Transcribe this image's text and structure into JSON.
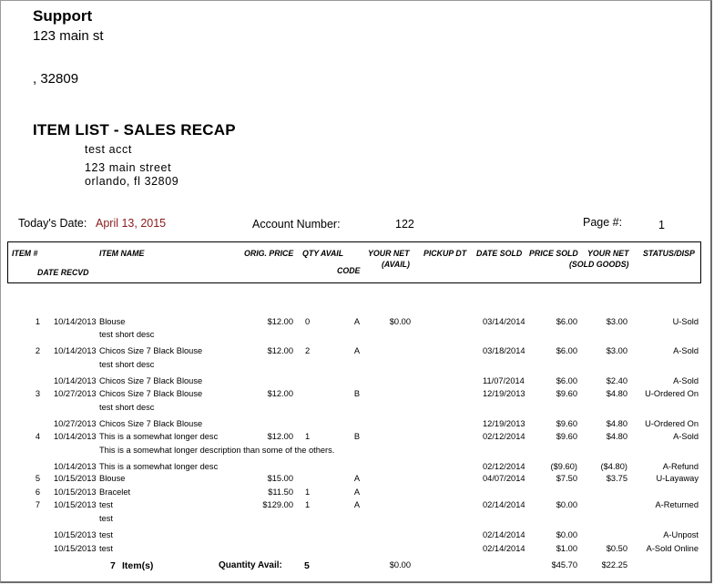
{
  "company": {
    "name": "Support",
    "address_line1": "123 main st",
    "address_line2": ",  32809"
  },
  "report": {
    "title": "ITEM LIST - SALES RECAP",
    "account_name": "test acct",
    "account_street": "123 main street",
    "account_city": "orlando, fl 32809",
    "todays_date_label": "Today's Date:",
    "todays_date_value": "April 13, 2015",
    "account_number_label": "Account Number:",
    "account_number_value": "122",
    "page_label": "Page #:",
    "page_value": "1"
  },
  "columns": {
    "item": "ITEM #",
    "item_name": "ITEM NAME",
    "orig_price": "ORIG. PRICE",
    "qty_avail": "QTY AVAIL",
    "your_net": "YOUR NET",
    "your_net_sub": "(AVAIL)",
    "pickup_dt": "PICKUP DT",
    "date_sold": "DATE SOLD",
    "price_sold": "PRICE SOLD",
    "your_net2": "YOUR NET",
    "your_net2_sub": "(SOLD GOODS)",
    "status": "STATUS/DISP",
    "date_recvd": "DATE RECVD",
    "code": "CODE"
  },
  "rows": [
    {
      "num": "1",
      "recvd": "10/14/2013",
      "name": "Blouse",
      "orig": "$12.00",
      "qty": "0",
      "code": "A",
      "net": "$0.00",
      "sold": "03/14/2014",
      "price": "$6.00",
      "net2": "$3.00",
      "status": "U-Sold"
    },
    {
      "name": "test short desc"
    },
    {
      "num": "2",
      "recvd": "10/14/2013",
      "name": "Chicos Size 7 Black Blouse",
      "orig": "$12.00",
      "qty": "2",
      "code": "A",
      "sold": "03/18/2014",
      "price": "$6.00",
      "net2": "$3.00",
      "status": "A-Sold"
    },
    {
      "name": "test short desc"
    },
    {
      "recvd": "10/14/2013",
      "name": "Chicos Size 7 Black Blouse",
      "sold": "11/07/2014",
      "price": "$6.00",
      "net2": "$2.40",
      "status": "A-Sold"
    },
    {
      "num": "3",
      "recvd": "10/27/2013",
      "name": "Chicos Size 7 Black Blouse",
      "orig": "$12.00",
      "code": "B",
      "sold": "12/19/2013",
      "price": "$9.60",
      "net2": "$4.80",
      "status": "U-Ordered On"
    },
    {
      "name": "test short desc"
    },
    {
      "recvd": "10/27/2013",
      "name": "Chicos Size 7 Black Blouse",
      "sold": "12/19/2013",
      "price": "$9.60",
      "net2": "$4.80",
      "status": "U-Ordered On"
    },
    {
      "num": "4",
      "recvd": "10/14/2013",
      "name": "This is a somewhat longer desc",
      "orig": "$12.00",
      "qty": "1",
      "code": "B",
      "sold": "02/12/2014",
      "price": "$9.60",
      "net2": "$4.80",
      "status": "A-Sold"
    },
    {
      "name": "This is a somewhat longer description than some of the others."
    },
    {
      "recvd": "10/14/2013",
      "name": "This is a somewhat longer desc",
      "sold": "02/12/2014",
      "price": "($9.60)",
      "net2": "($4.80)",
      "status": "A-Refund"
    },
    {
      "num": "5",
      "recvd": "10/15/2013",
      "name": "Blouse",
      "orig": "$15.00",
      "code": "A",
      "sold": "04/07/2014",
      "price": "$7.50",
      "net2": "$3.75",
      "status": "U-Layaway"
    },
    {
      "num": "6",
      "recvd": "10/15/2013",
      "name": "Bracelet",
      "orig": "$11.50",
      "qty": "1",
      "code": "A"
    },
    {
      "num": "7",
      "recvd": "10/15/2013",
      "name": "test",
      "orig": "$129.00",
      "qty": "1",
      "code": "A",
      "sold": "02/14/2014",
      "price": "$0.00",
      "status": "A-Returned"
    },
    {
      "name": "test"
    },
    {
      "recvd": "10/15/2013",
      "name": "test",
      "sold": "02/14/2014",
      "price": "$0.00",
      "status": "A-Unpost"
    },
    {
      "recvd": "10/15/2013",
      "name": "test",
      "sold": "02/14/2014",
      "price": "$1.00",
      "net2": "$0.50",
      "status": "A-Sold Online"
    }
  ],
  "footer": {
    "item_count": "7",
    "items_label": "Item(s)",
    "qty_label": "Quantity Avail:",
    "qty_value": "5",
    "net_avail_total": "$0.00",
    "price_sold_total": "$45.70",
    "net_sold_total": "$22.25"
  }
}
